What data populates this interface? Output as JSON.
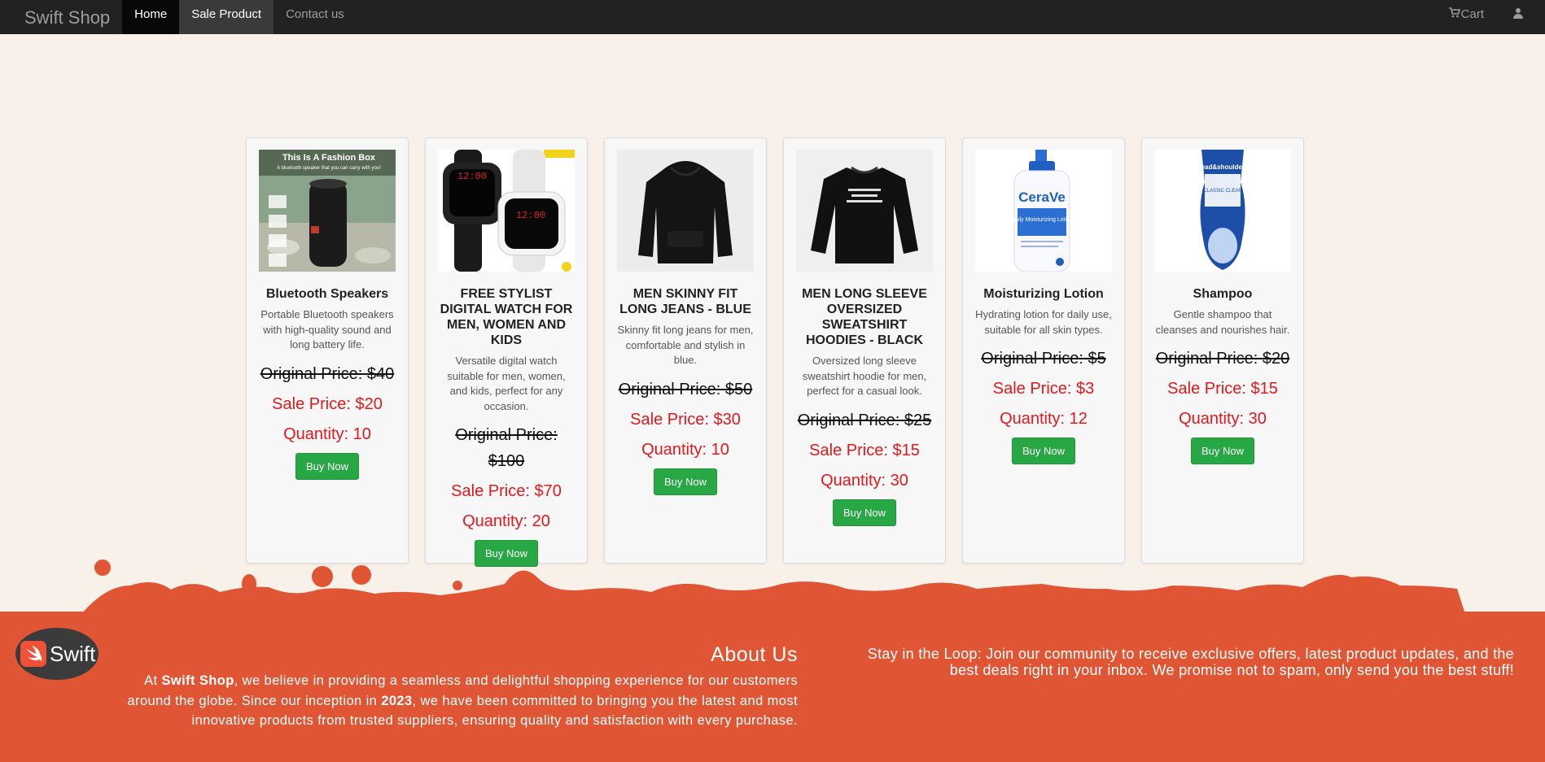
{
  "nav": {
    "brand": "Swift Shop",
    "links": [
      "Home",
      "Sale Product",
      "Contact us"
    ],
    "cart": "Cart"
  },
  "products": [
    {
      "title": "Bluetooth Speakers",
      "desc": "Portable Bluetooth speakers with high-quality sound and long battery life.",
      "orig_label": "Original Price:",
      "orig_value": "$40",
      "sale_label": "Sale Price:",
      "sale_value": "$20",
      "qty_label": "Quantity:",
      "qty_value": "10",
      "button": "Buy Now",
      "image_text": "This Is A Fashion Box",
      "image_subtext": "A bluetooth speaker that you can carry with you!"
    },
    {
      "title": "FREE STYLIST DIGITAL WATCH FOR MEN, WOMEN AND KIDS",
      "desc": "Versatile digital watch suitable for men, women, and kids, perfect for any occasion.",
      "orig_label": "Original Price:",
      "orig_value": "$100",
      "sale_label": "Sale Price:",
      "sale_value": "$70",
      "qty_label": "Quantity:",
      "qty_value": "20",
      "button": "Buy Now",
      "image_text": "12:00"
    },
    {
      "title": "MEN SKINNY FIT LONG JEANS - BLUE",
      "desc": "Skinny fit long jeans for men, comfortable and stylish in blue.",
      "orig_label": "Original Price:",
      "orig_value": "$50",
      "sale_label": "Sale Price:",
      "sale_value": "$30",
      "qty_label": "Quantity:",
      "qty_value": "10",
      "button": "Buy Now"
    },
    {
      "title": "MEN LONG SLEEVE OVERSIZED SWEATSHIRT HOODIES - BLACK",
      "desc": "Oversized long sleeve sweatshirt hoodie for men, perfect for a casual look.",
      "orig_label": "Original Price:",
      "orig_value": "$25",
      "sale_label": "Sale Price:",
      "sale_value": "$15",
      "qty_label": "Quantity:",
      "qty_value": "30",
      "button": "Buy Now"
    },
    {
      "title": "Moisturizing Lotion",
      "desc": "Hydrating lotion for daily use, suitable for all skin types.",
      "orig_label": "Original Price:",
      "orig_value": "$5",
      "sale_label": "Sale Price:",
      "sale_value": "$3",
      "qty_label": "Quantity:",
      "qty_value": "12",
      "button": "Buy Now",
      "image_text": "CeraVe",
      "image_subtext": "Daily Moisturizing Lotion"
    },
    {
      "title": "Shampoo",
      "desc": "Gentle shampoo that cleanses and nourishes hair.",
      "orig_label": "Original Price:",
      "orig_value": "$20",
      "sale_label": "Sale Price:",
      "sale_value": "$15",
      "qty_label": "Quantity:",
      "qty_value": "30",
      "button": "Buy Now",
      "image_text": "head&shoulders",
      "image_subtext": "CLASSIC CLEAN"
    }
  ],
  "footer": {
    "logo_text": "Swift",
    "about_title": "About Us",
    "about_pre": "At ",
    "about_brand": "Swift Shop",
    "about_mid": ", we believe in providing a seamless and delightful shopping experience for our customers around the globe. Since our inception in ",
    "about_year": "2023",
    "about_post": ", we have been committed to bringing you the latest and most innovative products from trusted suppliers, ensuring quality and satisfaction with every purchase.",
    "newsletter": "Stay in the Loop: Join our community to receive exclusive offers, latest product updates, and the best deals right in your inbox. We promise not to spam, only send you the best stuff!"
  },
  "colors": {
    "navbar": "#222222",
    "background": "#f8f1ea",
    "footer": "#e05533",
    "sale_red": "#e3181c",
    "buy_green": "#28a745"
  }
}
